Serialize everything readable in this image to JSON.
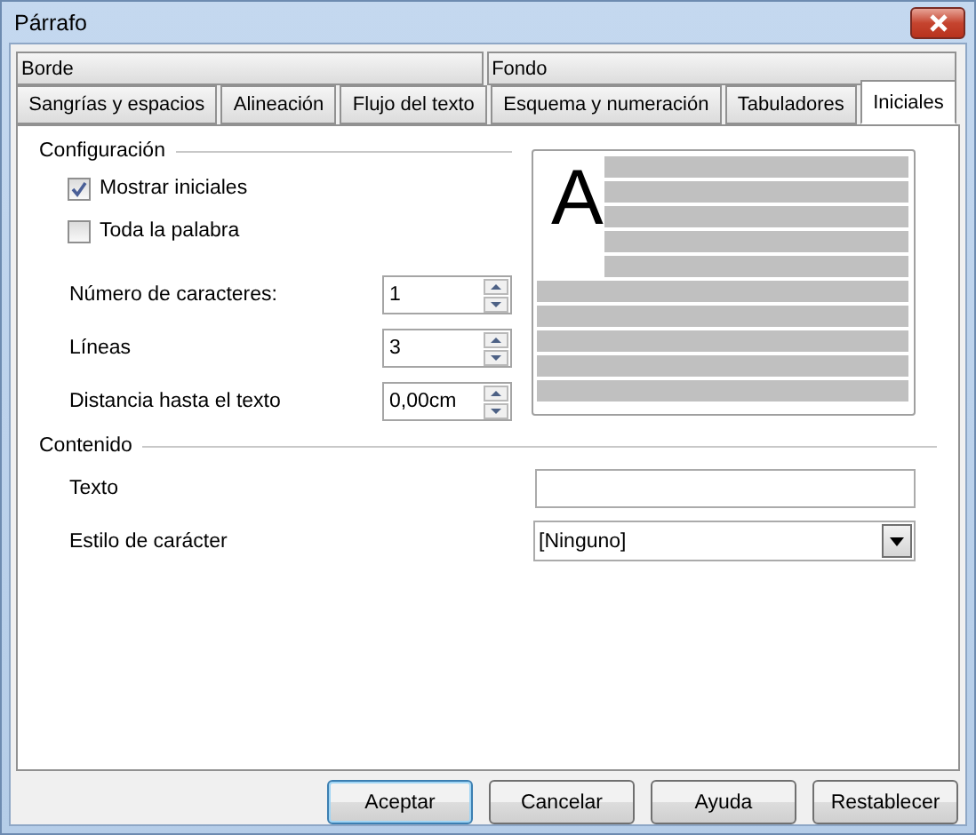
{
  "window": {
    "title": "Párrafo"
  },
  "tabs_top": [
    {
      "label": "Borde",
      "selected": false
    },
    {
      "label": "Fondo",
      "selected": false
    }
  ],
  "tabs": [
    {
      "label": "Sangrías y espacios",
      "selected": false
    },
    {
      "label": "Alineación",
      "selected": false
    },
    {
      "label": "Flujo del texto",
      "selected": false
    },
    {
      "label": "Esquema y numeración",
      "selected": false
    },
    {
      "label": "Tabuladores",
      "selected": false
    },
    {
      "label": "Iniciales",
      "selected": true
    }
  ],
  "configuracion": {
    "heading": "Configuración",
    "checkboxes": [
      {
        "label": "Mostrar iniciales",
        "checked": true
      },
      {
        "label": "Toda la palabra",
        "checked": false
      }
    ],
    "fields": [
      {
        "label": "Número de caracteres:",
        "value": "1"
      },
      {
        "label": "Líneas",
        "value": "3"
      },
      {
        "label": "Distancia hasta el texto",
        "value": "0,00cm"
      }
    ]
  },
  "preview": {
    "letter": "A"
  },
  "contenido": {
    "heading": "Contenido",
    "text_label": "Texto",
    "style_label": "Estilo de carácter",
    "style_value": "[Ninguno]"
  },
  "buttons": [
    {
      "label": "Aceptar",
      "default": true
    },
    {
      "label": "Cancelar",
      "default": false
    },
    {
      "label": "Ayuda",
      "default": false
    },
    {
      "label": "Restablecer",
      "default": false
    }
  ]
}
